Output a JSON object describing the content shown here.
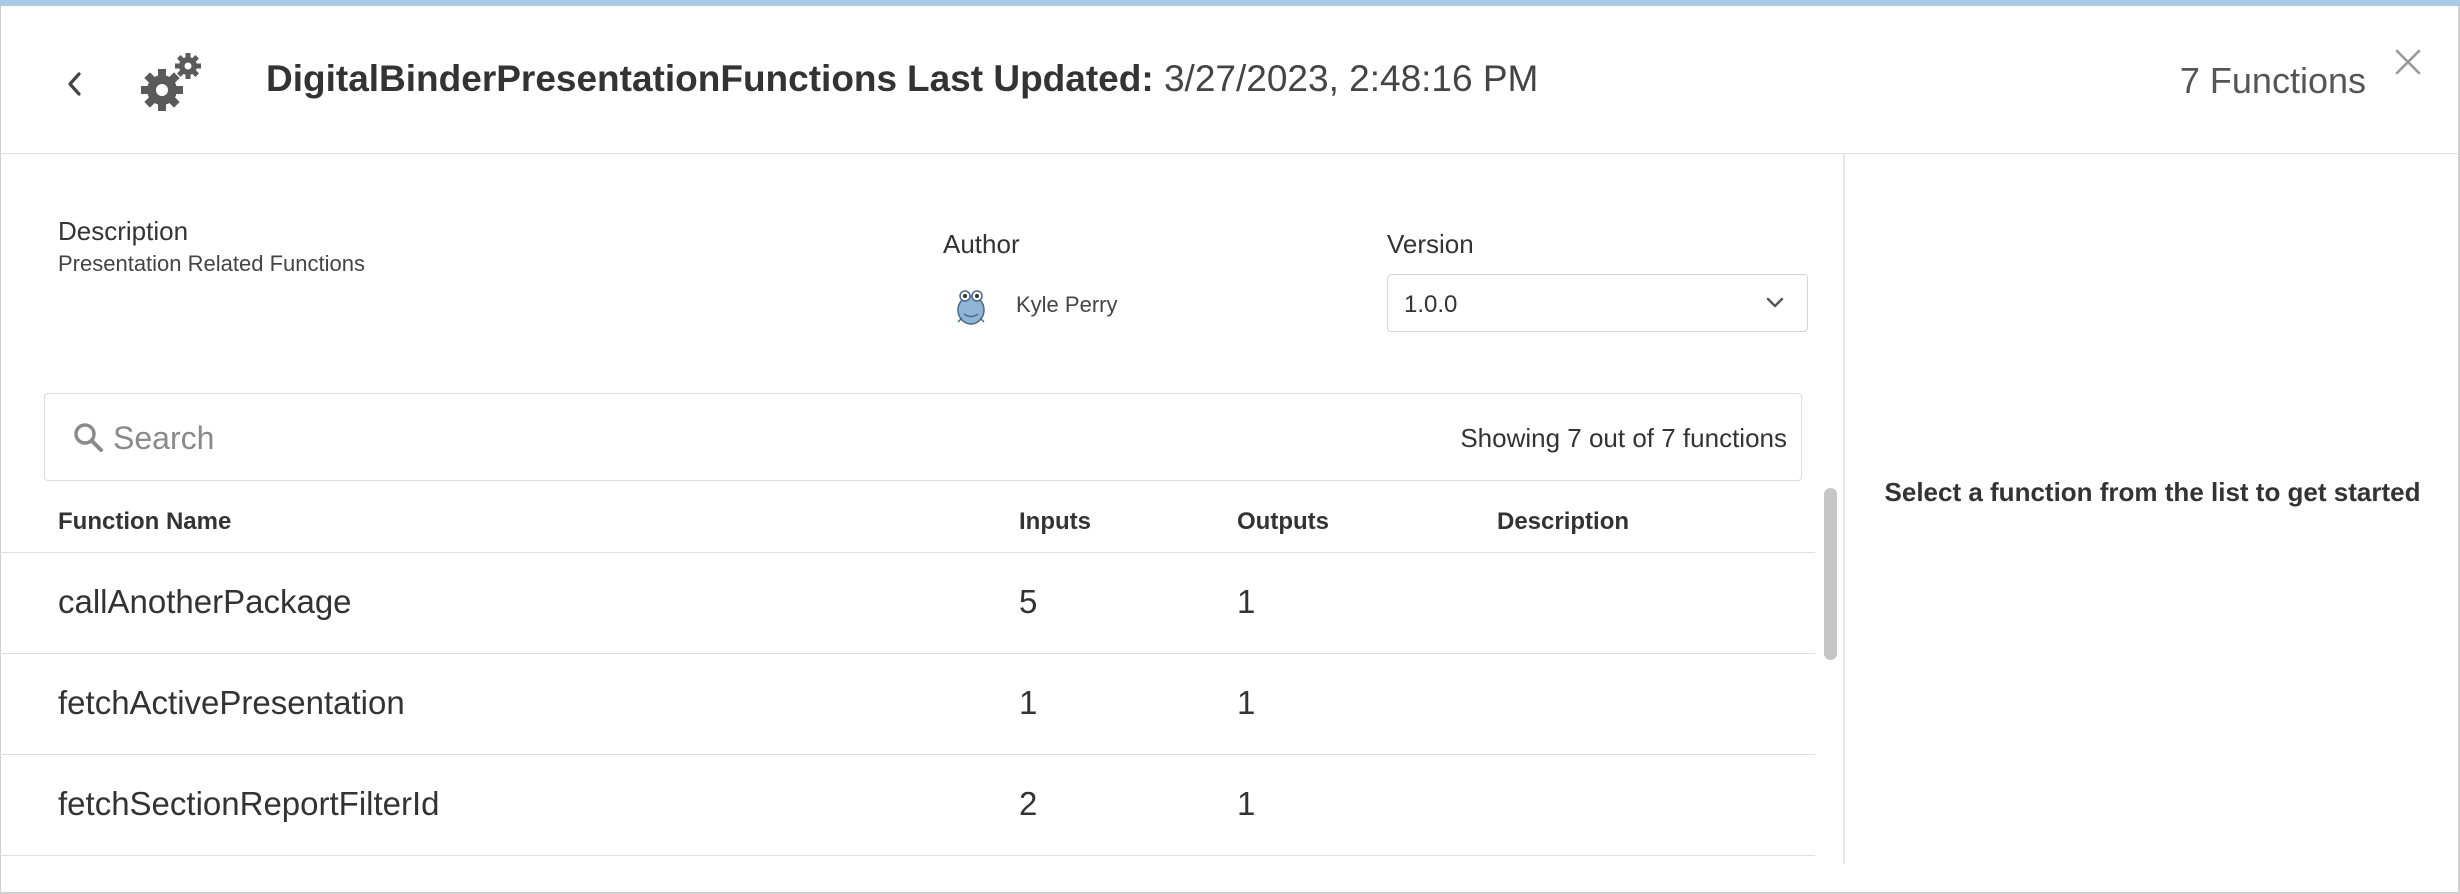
{
  "header": {
    "title": "DigitalBinderPresentationFunctions",
    "last_updated_label": "Last Updated:",
    "last_updated_value": "3/27/2023, 2:48:16 PM",
    "function_count": "7 Functions"
  },
  "details": {
    "description_label": "Description",
    "description_value": "Presentation Related Functions",
    "author_label": "Author",
    "author_name": "Kyle Perry",
    "version_label": "Version",
    "version_value": "1.0.0"
  },
  "search": {
    "placeholder": "Search",
    "showing_text": "Showing 7 out of 7 functions"
  },
  "table": {
    "columns": [
      "Function Name",
      "Inputs",
      "Outputs",
      "Description"
    ],
    "rows": [
      {
        "name": "callAnotherPackage",
        "inputs": "5",
        "outputs": "1",
        "description": ""
      },
      {
        "name": "fetchActivePresentation",
        "inputs": "1",
        "outputs": "1",
        "description": ""
      },
      {
        "name": "fetchSectionReportFilterId",
        "inputs": "2",
        "outputs": "1",
        "description": ""
      }
    ]
  },
  "side_panel": {
    "message": "Select a function from the list to get started"
  },
  "icons": {
    "back": "chevron-left-icon",
    "package": "gears-icon",
    "close": "close-icon",
    "search": "search-icon",
    "version_dropdown": "chevron-down-icon"
  },
  "colors": {
    "top_accent": "#a9cbe6",
    "border": "#dedede",
    "text": "#333333",
    "scroll_thumb": "#c6c6c6"
  }
}
